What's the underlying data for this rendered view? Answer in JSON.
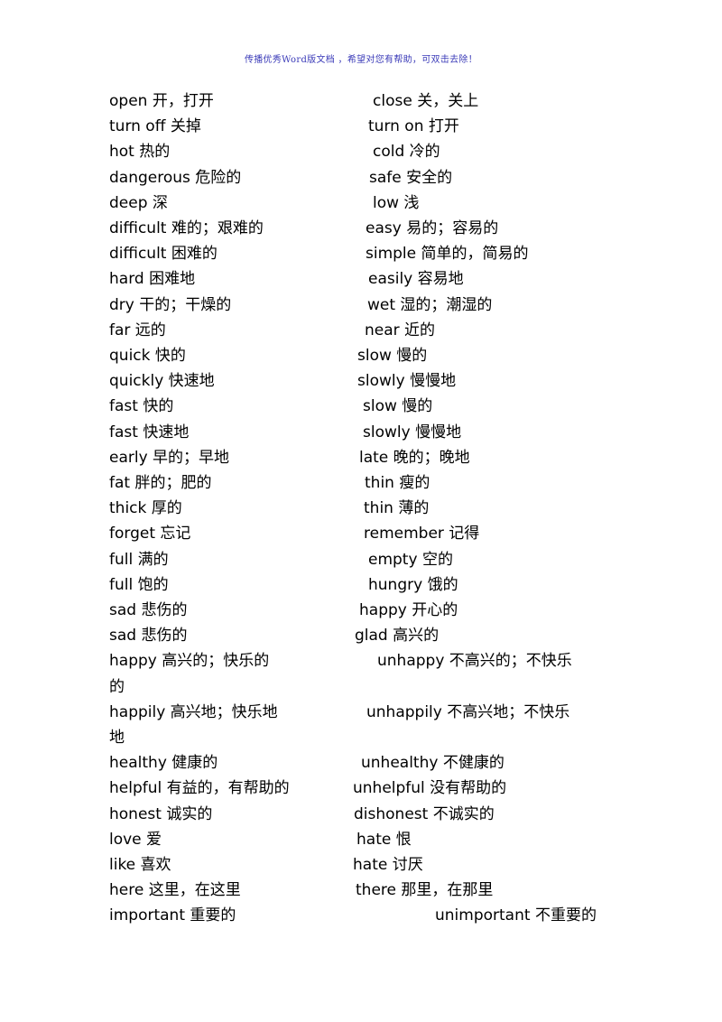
{
  "header": {
    "text": "传播优秀Word版文档 ，希望对您有帮助，可双击去除！"
  },
  "rows": [
    {
      "left": "open 开，打开",
      "right": "close 关，关上",
      "rx": 413
    },
    {
      "left": "turn off 关掉",
      "right": "turn on  打开",
      "rx": 408
    },
    {
      "left": "hot  热的",
      "right": "cold 冷的",
      "rx": 413
    },
    {
      "left": "dangerous 危险的",
      "right": "safe 安全的",
      "rx": 409
    },
    {
      "left": "deep 深",
      "right": "low  浅",
      "rx": 413
    },
    {
      "left": "difficult  难的；艰难的",
      "right": "easy 易的；容易的",
      "rx": 405
    },
    {
      "left": "difficult  困难的",
      "right": "simple 简单的，简易的",
      "rx": 405
    },
    {
      "left": "hard 困难地",
      "right": "easily 容易地",
      "rx": 408
    },
    {
      "left": "dry 干的；干燥的",
      "right": "wet 湿的；潮湿的",
      "rx": 407
    },
    {
      "left": "far 远的",
      "right": "near 近的",
      "rx": 404
    },
    {
      "left": "quick 快的",
      "right": "slow 慢的",
      "rx": 396
    },
    {
      "left": "quickly  快速地",
      "right": "slowly 慢慢地",
      "rx": 396
    },
    {
      "left": "fast 快的",
      "right": "slow 慢的",
      "rx": 402
    },
    {
      "left": "fast 快速地",
      "right": "slowly 慢慢地",
      "rx": 402
    },
    {
      "left": "early  早的；早地",
      "right": "late 晚的；晚地",
      "rx": 398
    },
    {
      "left": "fat 胖的；肥的",
      "right": "thin 瘦的",
      "rx": 404
    },
    {
      "left": "thick 厚的",
      "right": "thin 薄的",
      "rx": 403
    },
    {
      "left": "forget 忘记",
      "right": "remember 记得",
      "rx": 403
    },
    {
      "left": "full 满的",
      "right": "empty 空的",
      "rx": 408
    },
    {
      "left": "full 饱的",
      "right": "hungry 饿的",
      "rx": 408
    },
    {
      "left": "sad 悲伤的",
      "right": "happy 开心的",
      "rx": 398
    },
    {
      "left": "sad  悲伤的",
      "right": "glad 高兴的",
      "rx": 393
    },
    {
      "left": "happy 高兴的；快乐的",
      "right": "unhappy    不高兴的；不快乐",
      "rx": 418,
      "cont": "的"
    },
    {
      "left": "happily 高兴地；快乐地",
      "right": "unhappily    不高兴地；不快乐",
      "rx": 406,
      "cont": "地"
    },
    {
      "left": "healthy  健康的",
      "right": "unhealthy 不健康的",
      "rx": 400
    },
    {
      "left": "helpful 有益的，有帮助的",
      "right": "unhelpful 没有帮助的",
      "rx": 391
    },
    {
      "left": "honest  诚实的",
      "right": "dishonest 不诚实的",
      "rx": 392
    },
    {
      "left": "love 爱",
      "right": "hate 恨",
      "rx": 395
    },
    {
      "left": "like 喜欢",
      "right": "hate  讨厌",
      "rx": 391
    },
    {
      "left": "here  这里，在这里",
      "right": "there 那里，在那里",
      "rx": 394
    },
    {
      "left": "important   重要的",
      "right": "unimportant 不重要的",
      "rx": 482
    }
  ]
}
